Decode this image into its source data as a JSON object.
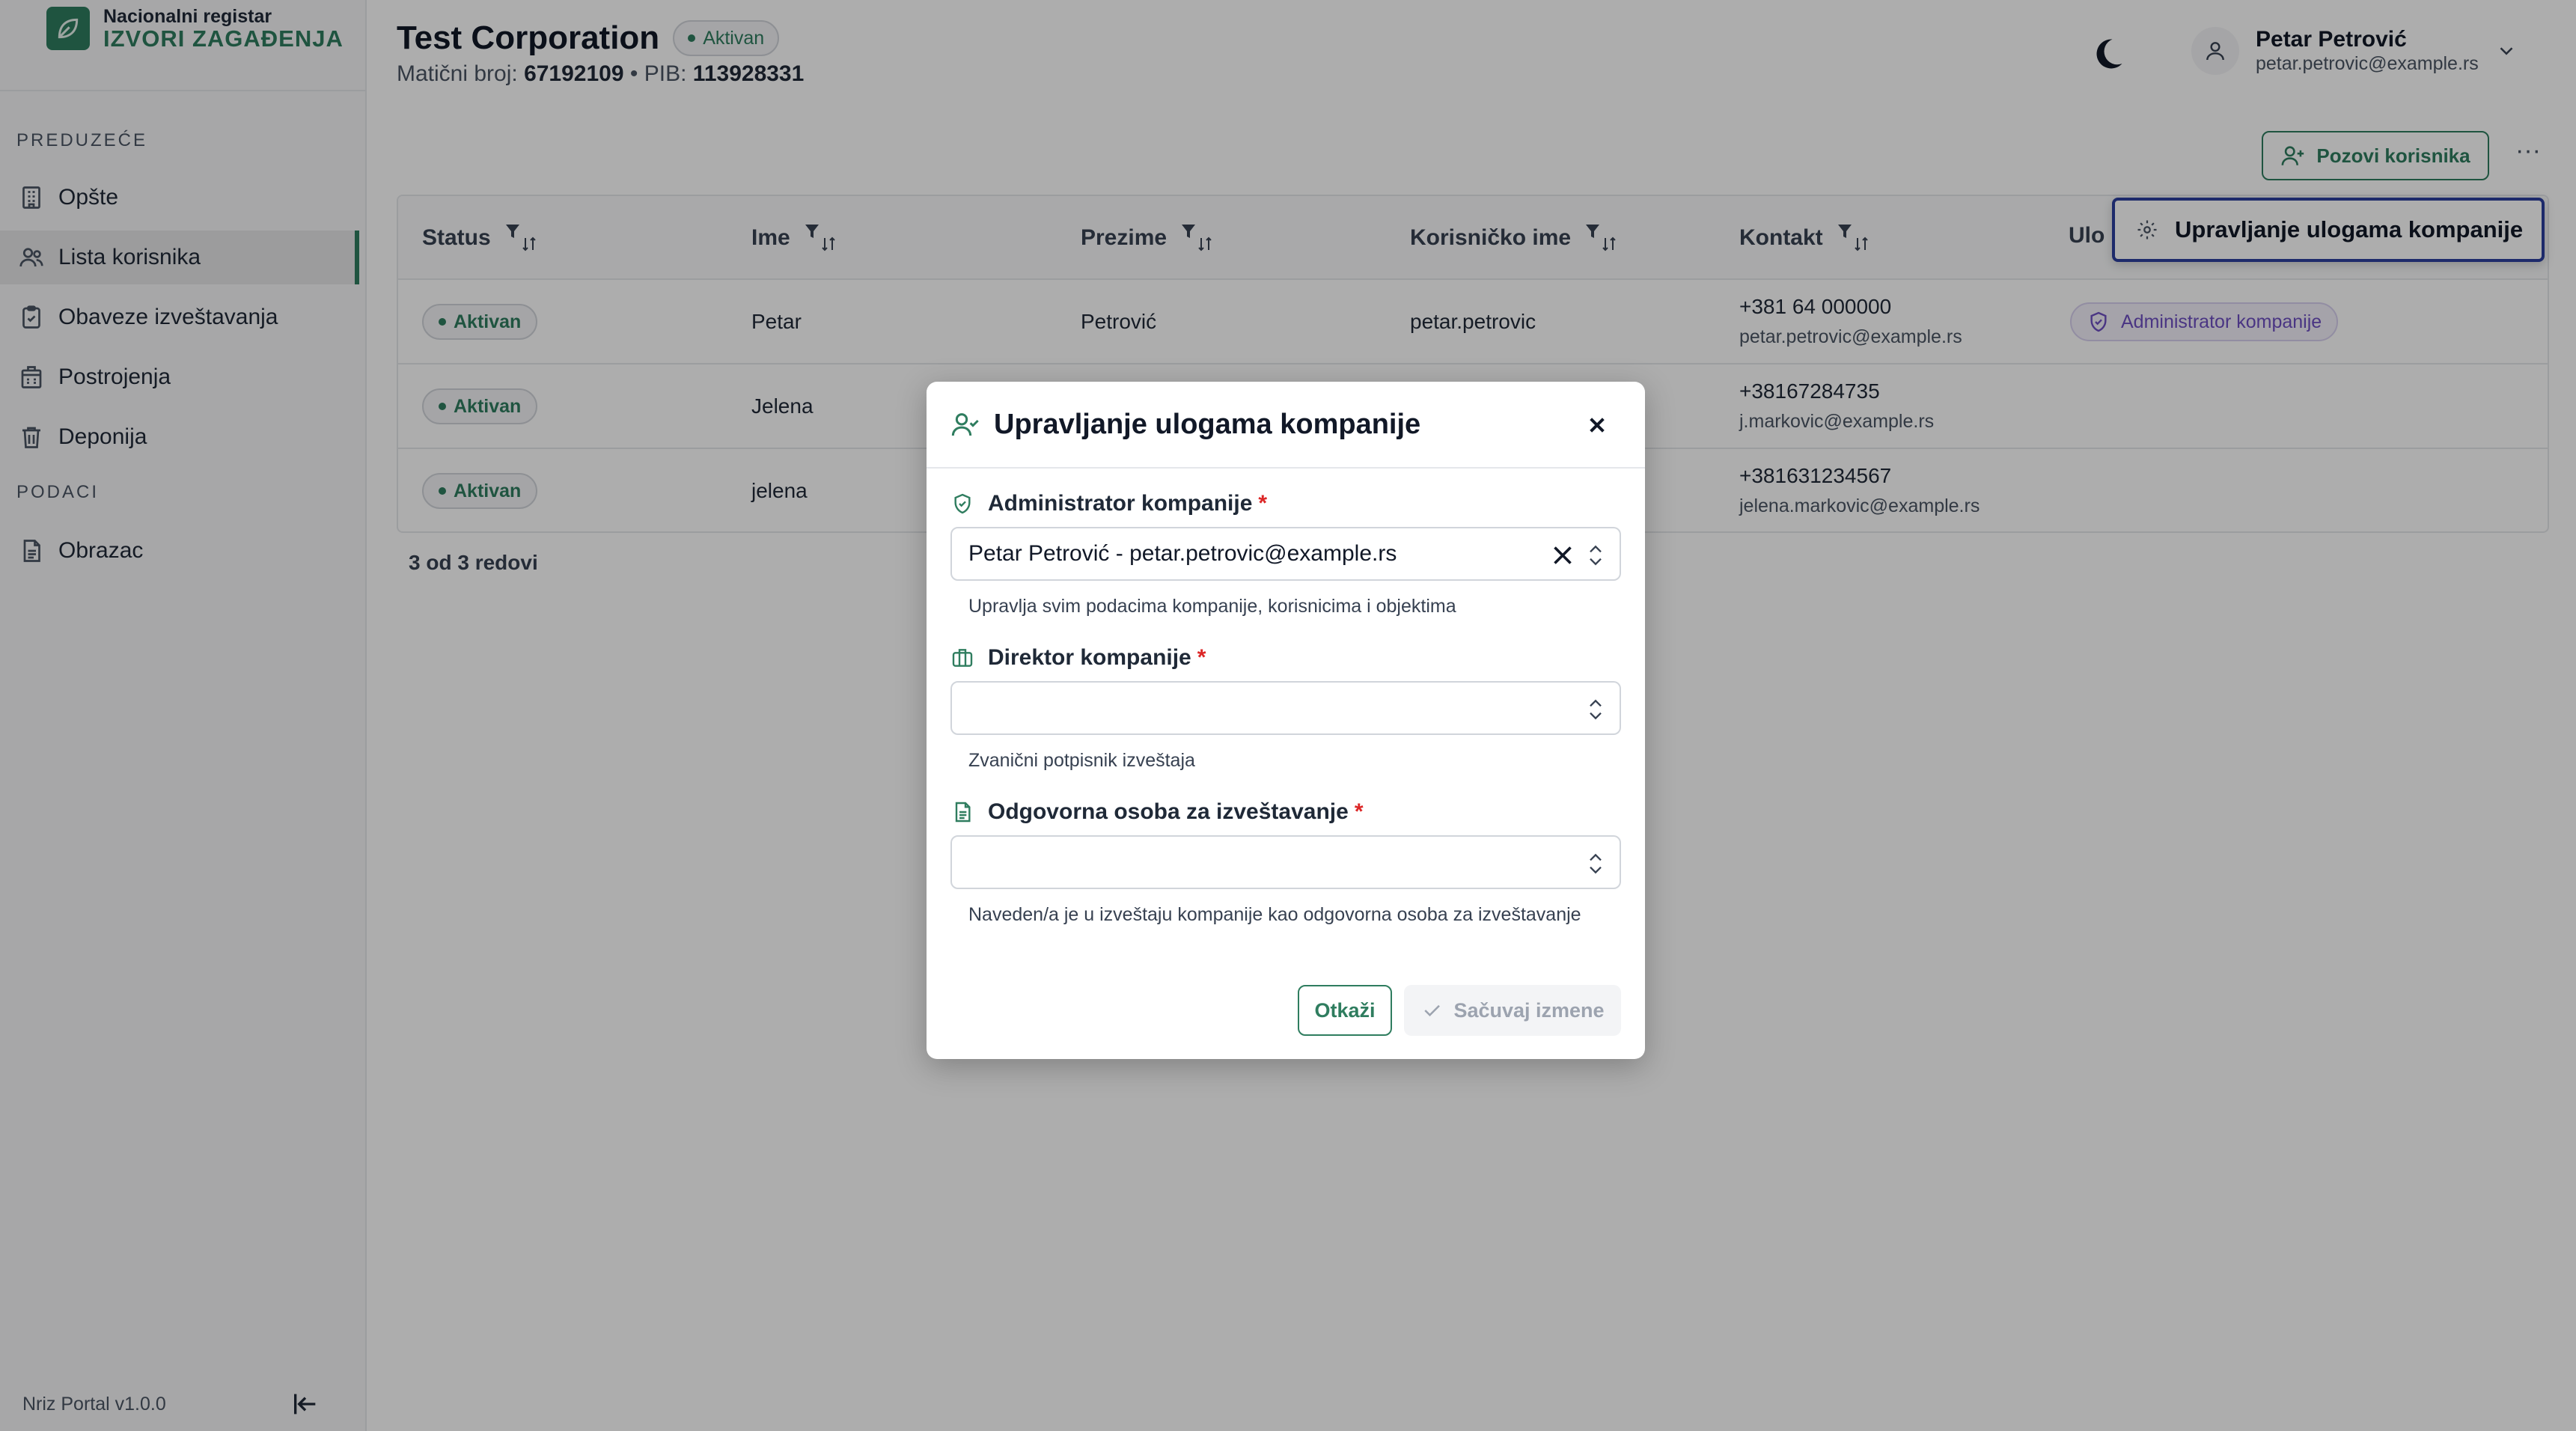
{
  "app": {
    "logo_line1": "Nacionalni registar",
    "logo_line2": "IZVORI ZAGAĐENJA",
    "version": "Nriz Portal v1.0.0"
  },
  "sidebar": {
    "section1": "PREDUZEĆE",
    "section2": "PODACI",
    "items": [
      {
        "label": "Opšte",
        "icon": "building-icon"
      },
      {
        "label": "Lista korisnika",
        "icon": "users-icon",
        "active": true
      },
      {
        "label": "Obaveze izveštavanja",
        "icon": "clipboard-check-icon"
      },
      {
        "label": "Postrojenja",
        "icon": "factory-icon"
      },
      {
        "label": "Deponija",
        "icon": "trash-icon"
      },
      {
        "label": "Obrazac",
        "icon": "document-icon"
      }
    ]
  },
  "header": {
    "company": "Test Corporation",
    "status": "Aktivan",
    "maticni_label": "Matični broj:",
    "maticni": "67192109",
    "separator": "•",
    "pib_label": "PIB:",
    "pib": "113928331",
    "user_name": "Petar Petrović",
    "user_email": "petar.petrovic@example.rs",
    "invite_label": "Pozovi korisnika",
    "more_label": "···"
  },
  "table": {
    "columns": [
      "Status",
      "Ime",
      "Prezime",
      "Korisničko ime",
      "Kontakt",
      "Ulo"
    ],
    "rows": [
      {
        "status": "Aktivan",
        "ime": "Petar",
        "prezime": "Petrović",
        "username": "petar.petrovic",
        "phone": "+381 64 000000",
        "email": "petar.petrovic@example.rs",
        "role": "Administrator kompanije"
      },
      {
        "status": "Aktivan",
        "ime": "Jelena",
        "prezime": "",
        "username": "",
        "phone": "+38167284735",
        "email": "j.markovic@example.rs",
        "role": ""
      },
      {
        "status": "Aktivan",
        "ime": "jelena",
        "prezime": "",
        "username": "",
        "phone": "+381631234567",
        "email": "jelena.markovic@example.rs",
        "role": ""
      }
    ],
    "rows_count": "3 od 3 redovi"
  },
  "role_menu": {
    "label": "Upravljanje ulogama kompanije"
  },
  "modal": {
    "title": "Upravljanje ulogama kompanije",
    "fields": [
      {
        "label": "Administrator kompanije",
        "required": "*",
        "value": "Petar Petrović - petar.petrovic@example.rs",
        "hint": "Upravlja svim podacima kompanije, korisnicima i objektima"
      },
      {
        "label": "Direktor kompanije",
        "required": "*",
        "value": "",
        "hint": "Zvanični potpisnik izveštaja"
      },
      {
        "label": "Odgovorna osoba za izveštavanje",
        "required": "*",
        "value": "",
        "hint": "Naveden/a je u izveštaju kompanije kao odgovorna osoba za izveštavanje"
      }
    ],
    "cancel_label": "Otkaži",
    "save_label": "Sačuvaj izmene"
  },
  "colors": {
    "brand": "#2f7d5f",
    "role_accent": "#6d4fc2",
    "required": "#dc2626",
    "focus": "#2c3e9e"
  }
}
